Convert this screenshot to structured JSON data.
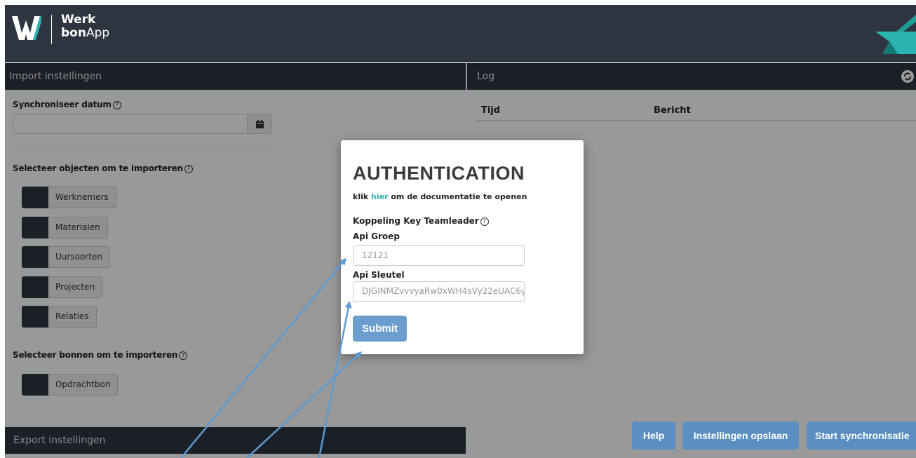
{
  "header": {
    "logo_line1": "Werk",
    "logo_line2_bold": "bon",
    "logo_line2_rest": "App"
  },
  "import_section": {
    "title": "Import instellingen",
    "sync_date_label": "Synchroniseer datum",
    "sync_date_value": "",
    "objects_label": "Selecteer objecten om te importeren",
    "objects": [
      {
        "label": "Werknemers"
      },
      {
        "label": "Materialen"
      },
      {
        "label": "Uursoorten"
      },
      {
        "label": "Projecten"
      },
      {
        "label": "Relaties"
      }
    ],
    "bonnen_label": "Selecteer bonnen om te importeren",
    "bonnen": [
      {
        "label": "Opdrachtbon"
      }
    ]
  },
  "export_section": {
    "title": "Export instellingen"
  },
  "log_section": {
    "title": "Log",
    "columns": [
      "Tijd",
      "Bericht"
    ]
  },
  "actions": {
    "help": "Help",
    "save": "Instellingen opslaan",
    "start": "Start synchronisatie"
  },
  "modal": {
    "title": "AUTHENTICATION",
    "link_prefix": "klik ",
    "link_text": "hier",
    "link_suffix": " om de documentatie te openen",
    "key_label": "Koppeling Key Teamleader",
    "api_group_label": "Api Groep",
    "api_group_value": "12121",
    "api_key_label": "Api Sleutel",
    "api_key_value": "DJGINMZvvvyaRw0xWH4sVy22eUAC6y",
    "submit": "Submit"
  },
  "colors": {
    "dark": "#2e3440",
    "accent_teal": "#2bb5b0",
    "button_blue": "#5b8fc2",
    "arrow_blue": "#5b9bd5"
  }
}
